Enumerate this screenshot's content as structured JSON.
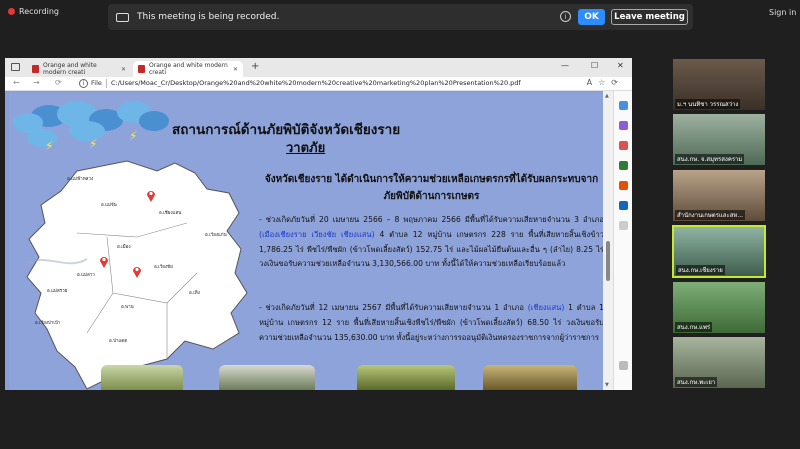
{
  "meeting": {
    "recording_label": "Recording",
    "banner_text": "This meeting is being recorded.",
    "ok_label": "OK",
    "leave_label": "Leave meeting",
    "signin_label": "Sign in"
  },
  "browser": {
    "tabs": [
      {
        "label": "Orange and white modern creati"
      },
      {
        "label": "Orange and white modern creati"
      }
    ],
    "new_tab": "+",
    "window_controls": [
      "—",
      "☐",
      "✕"
    ],
    "file_label": "File",
    "url": "C:/Users/Moac_Cr/Desktop/Orange%20and%20white%20modern%20creative%20marketing%20plan%20Presentation%20.pdf",
    "page_tools": "A☆⟳"
  },
  "slide": {
    "title": "สถานการณ์ด้านภัยพิบัติจังหวัดเชียงราย",
    "subtitle": "วาตภัย",
    "heading": "จังหวัดเชียงราย ได้ดำเนินการให้ความช่วยเหลือเกษตรกรที่ได้รับผลกระทบจากภัยพิบัติด้านการเกษตร",
    "para1_a": "- ช่วงเกิดภัยวันที่ 20 เมษายน 2566 – 8 พฤษภาคม 2566 มีพื้นที่ได้รับความเสียหายจำนวน 3 อำเภอ ",
    "para1_hl": "(เมืองเชียงราย เวียงชัย เชียงแสน)",
    "para1_b": " 4 ตำบล 12 หมู่บ้าน เกษตรกร 228 ราย พื้นที่เสียหายสิ้นเชิงข้าว 1,786.25 ไร่ พืชไร่/พืชผัก (ข้าวโพดเลี้ยงสัตว์) 152.75 ไร่ และไม้ผลไม้ยืนต้นและอื่น ๆ (ลำไย) 8.25 ไร่ วงเงินขอรับความช่วยเหลือจำนวน 3,130,566.00 บาท ทั้งนี้ได้ให้ความช่วยเหลือเรียบร้อยแล้ว",
    "para2_a": "- ช่วงเกิดภัยวันที่ 12 เมษายน 2567 มีพื้นที่ได้รับความเสียหายจำนวน 1 อำเภอ ",
    "para2_hl": "(เชียงแสน)",
    "para2_b": " 1 ตำบล 1 หมู่บ้าน เกษตรกร 12 ราย พื้นที่เสียหายสิ้นเชิงพืชไร่/พืชผัก (ข้าวโพดเลี้ยงสัตว์) 68.50 ไร่ วงเงินขอรับความช่วยเหลือจำนวน 135,630.00 บาท ทั้งนี้อยู่ระหว่างการรออนุมัติเงินทดรองราชการจากผู้ว่าราชการ",
    "map_labels": [
      "อ.แม่ฟ้าหลวง",
      "อ.แม่จัน",
      "อ.เชียงแสน",
      "อ.เมือง",
      "อ.เวียงชัย",
      "อ.แม่ลาว",
      "อ.แม่สรวย",
      "อ.เวียงป่าเป้า",
      "อ.พาน",
      "อ.ป่าแดด",
      "อ.เทิง",
      "อ.เวียงแก่น"
    ]
  },
  "participants": [
    {
      "name": "ม.ฯ นนทิชา  วรรณสว่าง"
    },
    {
      "name": "สนง.กษ. จ.สมุทรสงคราม"
    },
    {
      "name": "สำนักงานเกษตรและสห..."
    },
    {
      "name": "สนง.กษ.เชียงราย"
    },
    {
      "name": "สนง.กษ.แพร่"
    },
    {
      "name": "สนง.กษ.พะเยา"
    }
  ],
  "colors": {
    "accent": "#2d8cff",
    "active_speaker": "#c6e92b",
    "slide_bg": "#8fa3db",
    "highlight_text": "#1636c8"
  }
}
